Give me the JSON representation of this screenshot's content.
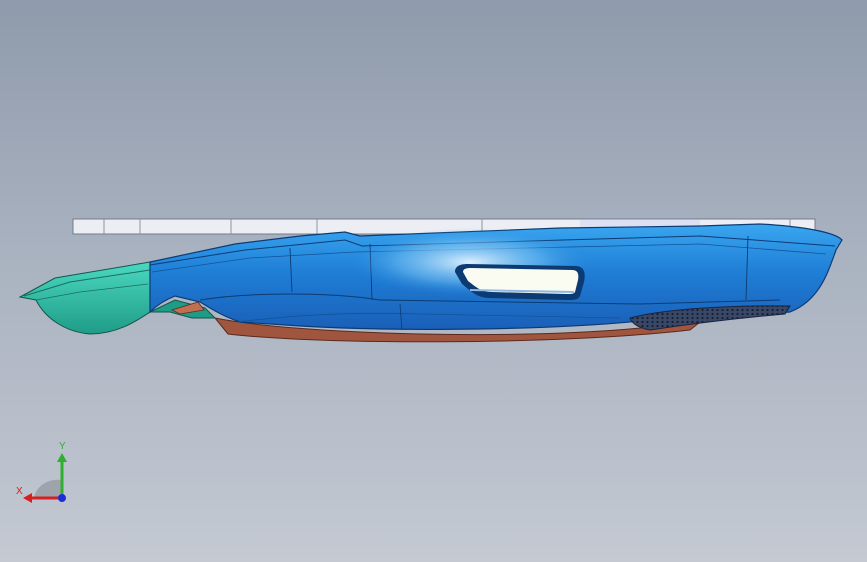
{
  "viewport": {
    "background_top": "#8f9aab",
    "background_bottom": "#c4c9d2"
  },
  "model": {
    "shell_color": "#1f7fd6",
    "front_color": "#2fc0a8",
    "underside_color": "#a0563e",
    "plate_color": "#eceef3",
    "vent_color": "#2a3550"
  },
  "triad": {
    "y_label": "Y",
    "x_label": "X",
    "y_color": "#2fae2f",
    "x_color": "#d42020",
    "z_color": "#1a2fd6"
  }
}
